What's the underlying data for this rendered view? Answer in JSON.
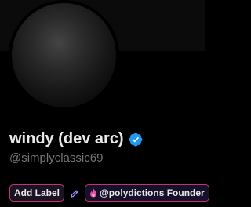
{
  "profile": {
    "display_name": "windy (dev arc)",
    "handle": "@simplyclassic69",
    "verified": true,
    "verified_color": "#1d9bf0"
  },
  "labels": {
    "add_label": "Add Label",
    "founder_label": "@polydictions Founder",
    "accent_color": "#c3366b"
  },
  "icons": {
    "verified": "verified-badge-icon",
    "edit": "pen-icon",
    "founder": "flame-icon"
  }
}
